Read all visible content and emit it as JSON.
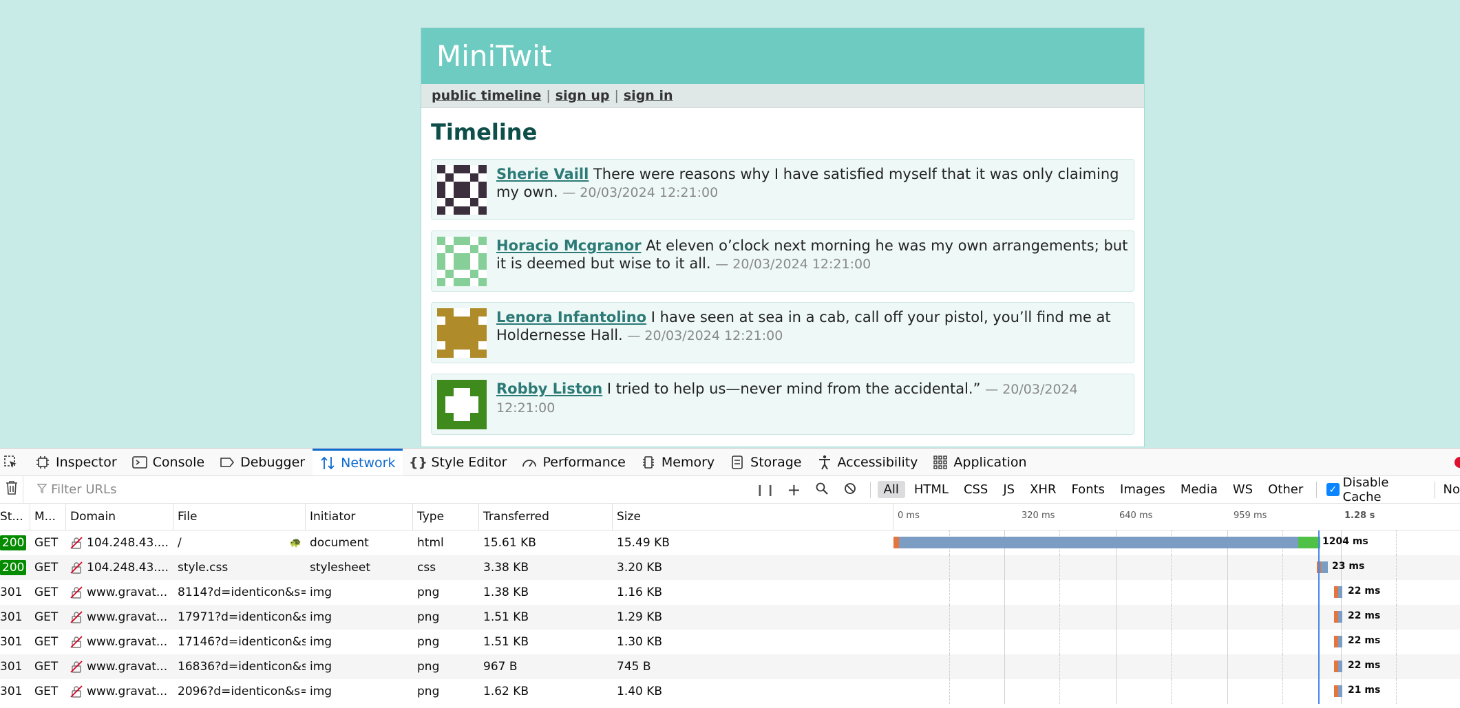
{
  "site": {
    "title": "MiniTwit",
    "nav": [
      {
        "label": "public timeline"
      },
      {
        "label": "sign up"
      },
      {
        "label": "sign in"
      }
    ],
    "nav_sep": "|",
    "heading": "Timeline",
    "messages": [
      {
        "user": "Sherie Vaill",
        "text": "There were reasons why I have satisfied myself that it was only claiming my own.",
        "date": "— 20/03/2024 12:21:00"
      },
      {
        "user": "Horacio Mcgranor",
        "text": "At eleven o’clock next morning he was my own arrangements; but it is deemed but wise to it all.",
        "date": "— 20/03/2024 12:21:00"
      },
      {
        "user": "Lenora Infantolino",
        "text": "I have seen at sea in a cab, call off your pistol, you’ll find me at Holdernesse Hall.",
        "date": "— 20/03/2024 12:21:00"
      },
      {
        "user": "Robby Liston",
        "text": "I tried to help us—never mind from the accidental.”",
        "date": "— 20/03/2024 12:21:00"
      }
    ]
  },
  "devtools": {
    "tabs": [
      {
        "label": "Inspector",
        "icon": "inspector-icon"
      },
      {
        "label": "Console",
        "icon": "console-icon"
      },
      {
        "label": "Debugger",
        "icon": "debugger-icon"
      },
      {
        "label": "Network",
        "icon": "network-icon",
        "active": true
      },
      {
        "label": "Style Editor",
        "icon": "style-editor-icon"
      },
      {
        "label": "Performance",
        "icon": "performance-icon"
      },
      {
        "label": "Memory",
        "icon": "memory-icon"
      },
      {
        "label": "Storage",
        "icon": "storage-icon"
      },
      {
        "label": "Accessibility",
        "icon": "accessibility-icon"
      },
      {
        "label": "Application",
        "icon": "application-icon"
      }
    ],
    "filter_placeholder": "Filter URLs",
    "type_filters": [
      "All",
      "HTML",
      "CSS",
      "JS",
      "XHR",
      "Fonts",
      "Images",
      "Media",
      "WS",
      "Other"
    ],
    "disable_cache_label": "Disable Cache",
    "throttle_label": "No",
    "columns": [
      "St...",
      "M...",
      "Domain",
      "File",
      "Initiator",
      "Type",
      "Transferred",
      "Size"
    ],
    "ticks": [
      "0 ms",
      "320 ms",
      "640 ms",
      "959 ms",
      "1.28 s"
    ],
    "requests": [
      {
        "status": "200",
        "method": "GET",
        "domain": "104.248.43....",
        "file": "/",
        "initiator": "document",
        "type": "html",
        "transferred": "15.61 KB",
        "size": "15.49 KB",
        "time": "1204 ms"
      },
      {
        "status": "200",
        "method": "GET",
        "domain": "104.248.43....",
        "file": "style.css",
        "initiator": "stylesheet",
        "type": "css",
        "transferred": "3.38 KB",
        "size": "3.20 KB",
        "time": "23 ms"
      },
      {
        "status": "301",
        "method": "GET",
        "domain": "www.gravat...",
        "file": "8114?d=identicon&s=",
        "initiator": "img",
        "type": "png",
        "transferred": "1.38 KB",
        "size": "1.16 KB",
        "time": "22 ms"
      },
      {
        "status": "301",
        "method": "GET",
        "domain": "www.gravat...",
        "file": "17971?d=identicon&s",
        "initiator": "img",
        "type": "png",
        "transferred": "1.51 KB",
        "size": "1.29 KB",
        "time": "22 ms"
      },
      {
        "status": "301",
        "method": "GET",
        "domain": "www.gravat...",
        "file": "17146?d=identicon&s",
        "initiator": "img",
        "type": "png",
        "transferred": "1.51 KB",
        "size": "1.30 KB",
        "time": "22 ms"
      },
      {
        "status": "301",
        "method": "GET",
        "domain": "www.gravat...",
        "file": "16836?d=identicon&s",
        "initiator": "img",
        "type": "png",
        "transferred": "967 B",
        "size": "745 B",
        "time": "22 ms"
      },
      {
        "status": "301",
        "method": "GET",
        "domain": "www.gravat...",
        "file": "2096?d=identicon&s=",
        "initiator": "img",
        "type": "png",
        "transferred": "1.62 KB",
        "size": "1.40 KB",
        "time": "21 ms"
      }
    ]
  },
  "colors": {
    "page_bg": "#c9ebe8",
    "header_bg": "#6ecbc1",
    "link": "#2b7a76",
    "active_tab": "#0b69d0",
    "status_ok": "#058b00"
  }
}
